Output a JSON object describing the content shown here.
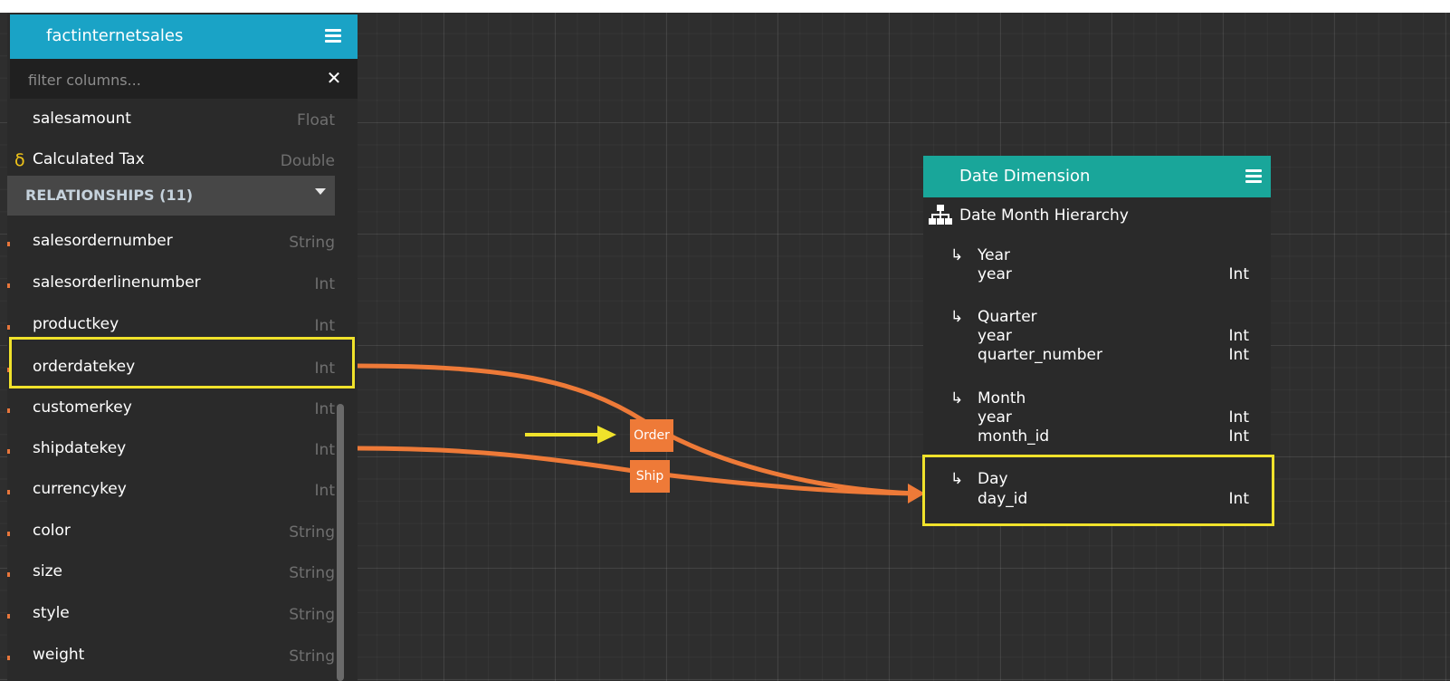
{
  "colors": {
    "canvas_bg": "#2e2e2e",
    "fact_header": "#1aa3c6",
    "dim_header": "#19a69a",
    "link": "#ee7a38",
    "highlight": "#f0e22b",
    "calc_symbol": "#f0c419"
  },
  "fact_table": {
    "title": "factinternetsales",
    "menu_icon": "hamburger-menu-icon",
    "filter": {
      "placeholder": "filter columns...",
      "value": ""
    },
    "clear_icon": "close-icon",
    "clear_glyph": "✕",
    "columns": [
      {
        "name": "salesamount",
        "type": "Float"
      },
      {
        "name": "Calculated Tax",
        "type": "Double",
        "calculated_symbol": "δ"
      }
    ],
    "relationships_header": "RELATIONSHIPS (11)",
    "relationships": [
      {
        "name": "salesordernumber",
        "type": "String"
      },
      {
        "name": "salesorderlinenumber",
        "type": "Int"
      },
      {
        "name": "productkey",
        "type": "Int"
      },
      {
        "name": "orderdatekey",
        "type": "Int"
      },
      {
        "name": "customerkey",
        "type": "Int"
      },
      {
        "name": "shipdatekey",
        "type": "Int"
      },
      {
        "name": "currencykey",
        "type": "Int"
      },
      {
        "name": "color",
        "type": "String"
      },
      {
        "name": "size",
        "type": "String"
      },
      {
        "name": "style",
        "type": "String"
      },
      {
        "name": "weight",
        "type": "String"
      }
    ]
  },
  "links": {
    "order_label": "Order",
    "ship_label": "Ship"
  },
  "date_dimension": {
    "title": "Date Dimension",
    "menu_icon": "hamburger-menu-icon",
    "hierarchy": {
      "name": "Date Month Hierarchy",
      "icon": "hierarchy-icon",
      "levels": [
        {
          "arrow": "↳",
          "name": "Year",
          "attributes": [
            {
              "name": "year",
              "type": "Int"
            }
          ]
        },
        {
          "arrow": "↳",
          "name": "Quarter",
          "attributes": [
            {
              "name": "year",
              "type": "Int"
            },
            {
              "name": "quarter_number",
              "type": "Int"
            }
          ]
        },
        {
          "arrow": "↳",
          "name": "Month",
          "attributes": [
            {
              "name": "year",
              "type": "Int"
            },
            {
              "name": "month_id",
              "type": "Int"
            }
          ]
        },
        {
          "arrow": "↳",
          "name": "Day",
          "attributes": [
            {
              "name": "day_id",
              "type": "Int"
            }
          ]
        }
      ]
    }
  }
}
